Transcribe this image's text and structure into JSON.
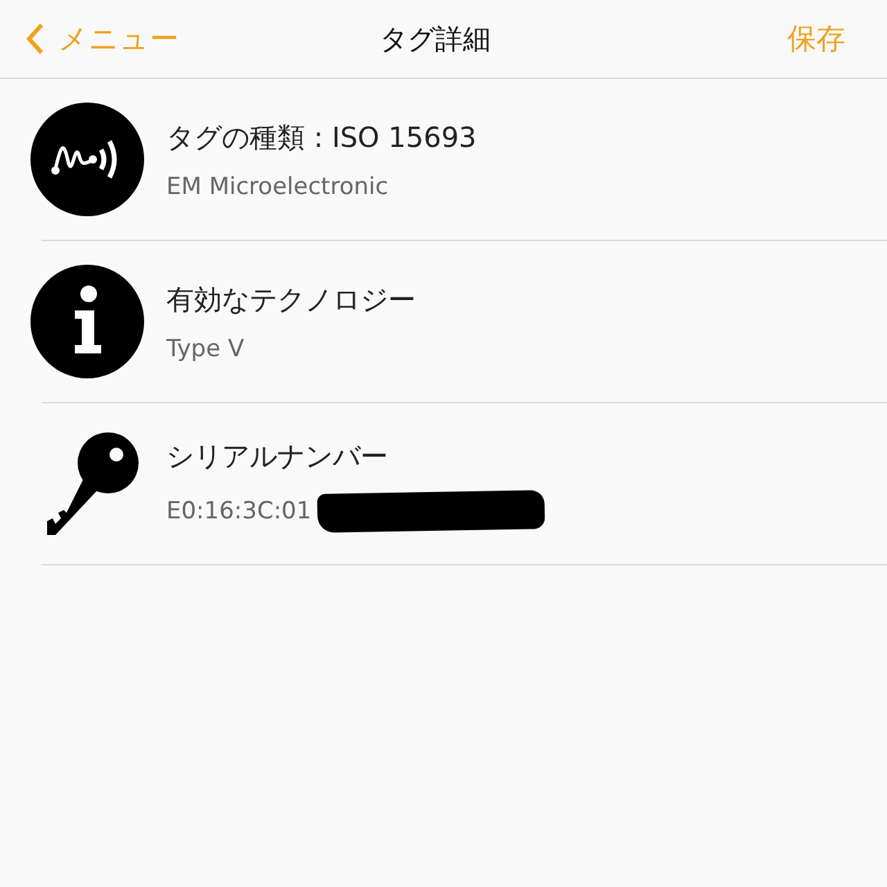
{
  "nav": {
    "back": "メニュー",
    "title": "タグ詳細",
    "action": "保存"
  },
  "rows": [
    {
      "kind": "tag",
      "title": "タグの種類 : ISO 15693",
      "subtitle": "EM Microelectronic"
    },
    {
      "kind": "info",
      "title": "有効なテクノロジー",
      "subtitle": "Type V"
    },
    {
      "kind": "key",
      "title": "シリアルナンバー",
      "subtitle": "E0:16:3C:01",
      "redacted": true
    }
  ]
}
